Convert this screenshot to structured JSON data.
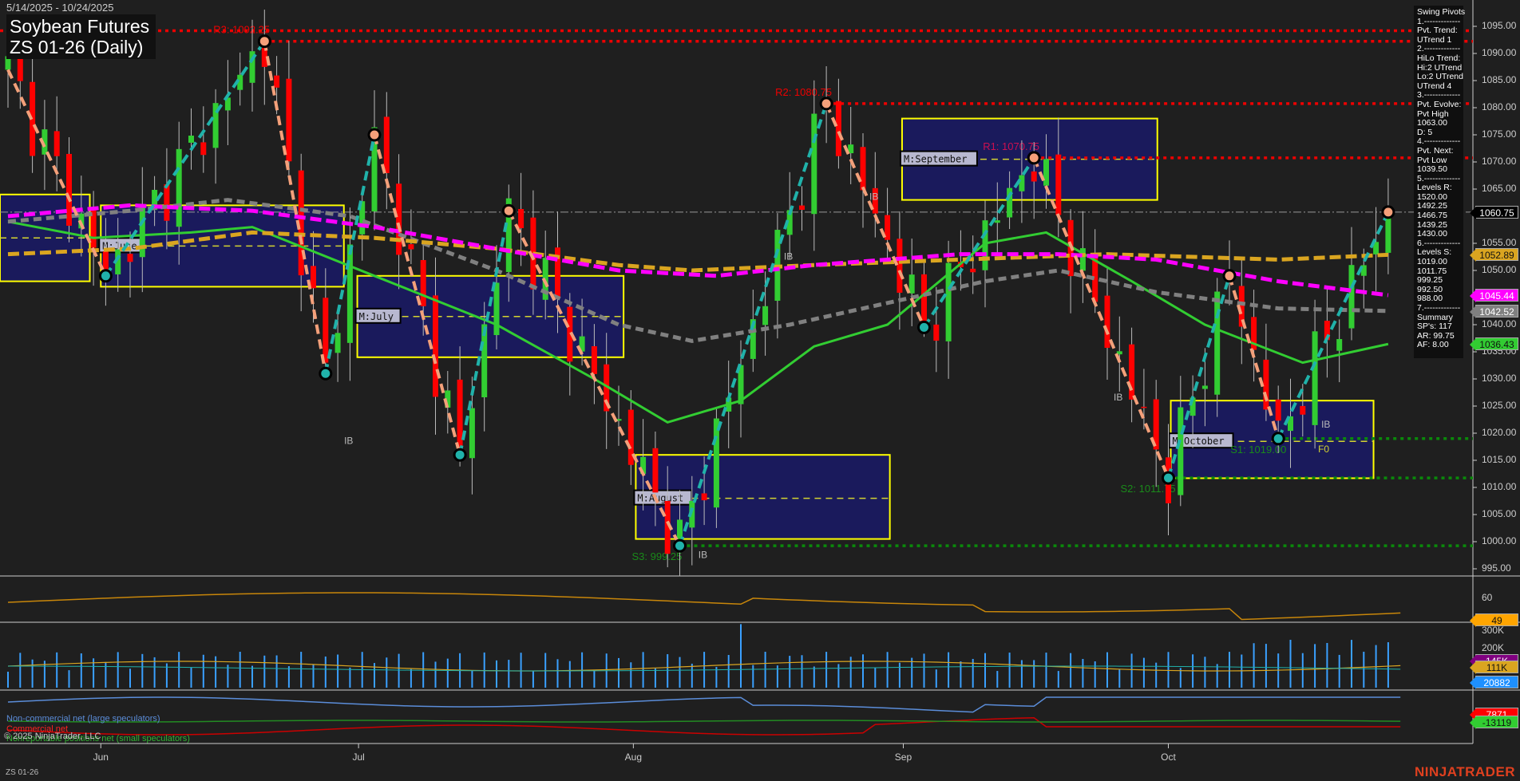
{
  "header": {
    "date_range": "5/14/2025 - 10/24/2025",
    "title_line1": "Soybean Futures",
    "title_line2": "ZS 01-26 (Daily)"
  },
  "pivot_panel": {
    "lines": [
      "Swing Pivots",
      "1.-------------",
      "Pvt. Trend:",
      "UTrend 1",
      "2.-------------",
      "HiLo Trend:",
      "Hi:2 UTrend",
      "Lo:2 UTrend",
      "UTrend 4",
      "3.-------------",
      "Pvt. Evolve:",
      "Pvt High",
      "1063.00",
      "D: 5",
      "4.-------------",
      "Pvt. Next:",
      "Pvt Low",
      "1039.50",
      "5.-------------",
      "Levels R:",
      "1520.00",
      "1492.25",
      "1466.75",
      "1439.25",
      "1430.00",
      "6.-------------",
      "Levels S:",
      "1019.00",
      "1011.75",
      "999.25",
      "992.50",
      "988.00",
      "7.-------------",
      "Summary",
      "SP's: 117",
      "AR: 99.75",
      "AF: 8.00"
    ]
  },
  "price_tags": [
    {
      "label": "1060.75",
      "value": 1060.75,
      "bg": "#000000",
      "fg": "#ffffff"
    },
    {
      "label": "1052.89",
      "value": 1052.89,
      "bg": "#daa520",
      "fg": "#111111"
    },
    {
      "label": "1045.44",
      "value": 1045.44,
      "bg": "#ff00ff",
      "fg": "#ffffff"
    },
    {
      "label": "1042.52",
      "value": 1042.52,
      "bg": "#808080",
      "fg": "#ffffff"
    },
    {
      "label": "1036.43",
      "value": 1036.43,
      "bg": "#32cd32",
      "fg": "#111111"
    }
  ],
  "indicator_tags": [
    {
      "label": "49",
      "bg": "#ffa500",
      "fg": "#111111",
      "panel": "osc"
    },
    {
      "label": "145K",
      "bg": "#800080",
      "fg": "#ffffff",
      "panel": "vol"
    },
    {
      "label": "111K",
      "bg": "#daa520",
      "fg": "#111111",
      "panel": "vol"
    },
    {
      "label": "20882",
      "bg": "#1e90ff",
      "fg": "#ffffff",
      "panel": "vol"
    },
    {
      "label": "7871",
      "bg": "#ff0000",
      "fg": "#ffffff",
      "panel": "cot"
    },
    {
      "label": "-13119",
      "bg": "#32cd32",
      "fg": "#111111",
      "panel": "cot"
    }
  ],
  "osc_ticks": [
    "60"
  ],
  "vol_ticks": [
    "300K",
    "200K"
  ],
  "cot_legend": {
    "noncommercial": "Non-commercial net (large speculators)",
    "commercial": "Commercial net",
    "nonreportable": "Nonreportable positions net (small speculators)"
  },
  "copyright": "© 2025 NinjaTrader, LLC",
  "footer": {
    "instrument": "ZS 01-26",
    "logo": "NINJATRADER"
  },
  "colors": {
    "bg": "#1f1f1f",
    "up": "#32cd32",
    "down": "#ff0000",
    "box_fill": "#1a1a5c",
    "box_border": "#ffff00"
  },
  "chart_data": {
    "type": "candlestick",
    "title": "Soybean Futures ZS 01-26 (Daily)",
    "ylim": [
      993,
      1098
    ],
    "y_ticks": [
      "1095.00",
      "1090.00",
      "1085.00",
      "1080.00",
      "1075.00",
      "1070.00",
      "1065.00",
      "1060.00",
      "1055.00",
      "1050.00",
      "1045.00",
      "1040.00",
      "1035.00",
      "1030.00",
      "1025.00",
      "1020.00",
      "1015.00",
      "1010.00",
      "1005.00",
      "1000.00",
      "995.00"
    ],
    "x_months": [
      {
        "label": "Jun",
        "bar": 7.6
      },
      {
        "label": "Jul",
        "bar": 28.7
      },
      {
        "label": "Aug",
        "bar": 51.2
      },
      {
        "label": "Sep",
        "bar": 73.3
      },
      {
        "label": "Oct",
        "bar": 95
      }
    ],
    "bar_count": 114,
    "swing_pivots": [
      [
        0,
        1087
      ],
      [
        8,
        1049
      ],
      [
        21,
        1092.25
      ],
      [
        26,
        1031
      ],
      [
        30,
        1075
      ],
      [
        37,
        1016
      ],
      [
        41,
        1061
      ],
      [
        55,
        999.25
      ],
      [
        67,
        1080.75
      ],
      [
        75,
        1039.5
      ],
      [
        84,
        1070.75
      ],
      [
        95,
        1011.75
      ],
      [
        100,
        1049
      ],
      [
        104,
        1019
      ],
      [
        113,
        1060.75
      ]
    ],
    "levels": [
      {
        "label": "R3: 1092.25",
        "value": 1092.25,
        "from": 21,
        "kind": "R"
      },
      {
        "label": "R2: 1080.75",
        "value": 1080.75,
        "from": 67,
        "kind": "R"
      },
      {
        "label": "R1: 1070.75",
        "value": 1070.75,
        "from": 84,
        "kind": "R"
      },
      {
        "label": "S1: 1019.00",
        "value": 1019.0,
        "from": 104,
        "kind": "S"
      },
      {
        "label": "S2: 1011.75",
        "value": 1011.75,
        "from": 95,
        "kind": "S"
      },
      {
        "label": "S3: 999.25",
        "value": 999.25,
        "from": 55,
        "kind": "S"
      }
    ],
    "last_price": 1060.75,
    "monthly_boxes": [
      {
        "label": "",
        "bars": [
          -1,
          6.7
        ],
        "hi": 1064,
        "lo": 1048,
        "mid": 1056
      },
      {
        "label": "M:June",
        "bars": [
          7.6,
          27.5
        ],
        "hi": 1062,
        "lo": 1047,
        "mid": 1054.5
      },
      {
        "label": "M:July",
        "bars": [
          28.6,
          50.4
        ],
        "hi": 1049,
        "lo": 1034,
        "mid": 1041.5
      },
      {
        "label": "M:August",
        "bars": [
          51.4,
          72.2
        ],
        "hi": 1016,
        "lo": 1000.5,
        "mid": 1008
      },
      {
        "label": "M:September",
        "bars": [
          73.2,
          94.1
        ],
        "hi": 1078,
        "lo": 1063,
        "mid": 1070.5
      },
      {
        "label": "M:October",
        "bars": [
          95.2,
          111.8
        ],
        "hi": 1026,
        "lo": 1011.7,
        "mid": 1018.5
      }
    ],
    "annotations": [
      "IB",
      "IB",
      "IB",
      "IB",
      "IB",
      "IB",
      "F0"
    ],
    "series": [
      {
        "name": "green-ma",
        "color": "#32cd32",
        "dash": "",
        "points": [
          [
            0,
            1059
          ],
          [
            7,
            1056
          ],
          [
            15,
            1057
          ],
          [
            20,
            1058
          ],
          [
            30,
            1049
          ],
          [
            40,
            1040
          ],
          [
            48,
            1030
          ],
          [
            54,
            1022
          ],
          [
            60,
            1026
          ],
          [
            66,
            1036
          ],
          [
            72,
            1040
          ],
          [
            80,
            1055
          ],
          [
            85,
            1057
          ],
          [
            92,
            1048
          ],
          [
            98,
            1040
          ],
          [
            106,
            1033
          ],
          [
            113,
            1036.43
          ]
        ]
      },
      {
        "name": "gray-ma",
        "color": "#808080",
        "dash": "10 6",
        "points": [
          [
            0,
            1059
          ],
          [
            10,
            1061
          ],
          [
            18,
            1063
          ],
          [
            28,
            1060
          ],
          [
            40,
            1050
          ],
          [
            50,
            1040
          ],
          [
            56,
            1037
          ],
          [
            64,
            1040
          ],
          [
            72,
            1044
          ],
          [
            80,
            1048
          ],
          [
            86,
            1050
          ],
          [
            94,
            1046
          ],
          [
            104,
            1043
          ],
          [
            113,
            1042.52
          ]
        ]
      },
      {
        "name": "orange-ma",
        "color": "#daa520",
        "dash": "14 6",
        "points": [
          [
            0,
            1053
          ],
          [
            10,
            1054
          ],
          [
            20,
            1057
          ],
          [
            30,
            1056
          ],
          [
            40,
            1054
          ],
          [
            50,
            1051
          ],
          [
            56,
            1050
          ],
          [
            66,
            1051
          ],
          [
            78,
            1052
          ],
          [
            90,
            1053
          ],
          [
            104,
            1052
          ],
          [
            113,
            1052.89
          ]
        ]
      },
      {
        "name": "magenta-ma",
        "color": "#ff00ff",
        "dash": "14 6",
        "points": [
          [
            0,
            1060
          ],
          [
            10,
            1062
          ],
          [
            20,
            1061
          ],
          [
            30,
            1058
          ],
          [
            40,
            1054
          ],
          [
            50,
            1050
          ],
          [
            58,
            1049
          ],
          [
            66,
            1051
          ],
          [
            78,
            1053
          ],
          [
            86,
            1053
          ],
          [
            94,
            1052
          ],
          [
            104,
            1048
          ],
          [
            113,
            1045.44
          ]
        ]
      }
    ]
  }
}
